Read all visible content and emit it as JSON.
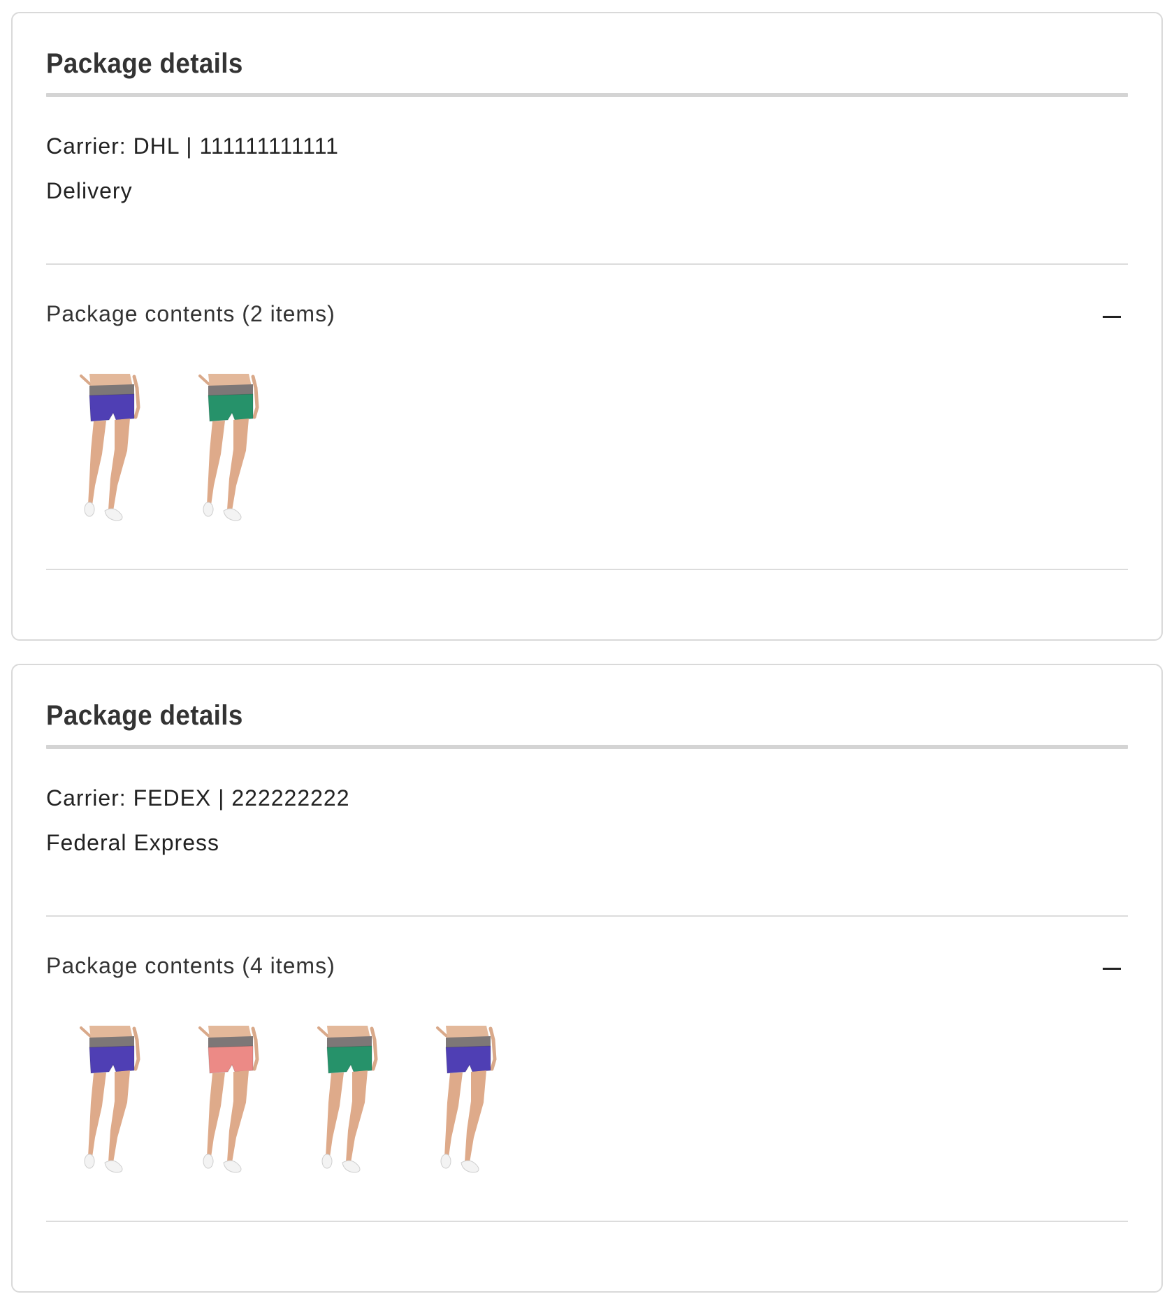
{
  "packages": [
    {
      "title": "Package details",
      "carrier_line": "Carrier: DHL | 111111111111",
      "method": "Delivery",
      "contents_label": "Package contents (2 items)",
      "toggle_icon": "minus-icon",
      "items": [
        {
          "product": "shorts",
          "color": "#4f3fb4"
        },
        {
          "product": "shorts",
          "color": "#26926a"
        }
      ]
    },
    {
      "title": "Package details",
      "carrier_line": "Carrier: FEDEX | 222222222",
      "method": "Federal Express",
      "contents_label": "Package contents (4 items)",
      "toggle_icon": "minus-icon",
      "items": [
        {
          "product": "shorts",
          "color": "#4f3fb4"
        },
        {
          "product": "shorts",
          "color": "#ec8a86"
        },
        {
          "product": "shorts",
          "color": "#26926a"
        },
        {
          "product": "shorts",
          "color": "#4f3fb4"
        }
      ]
    }
  ]
}
